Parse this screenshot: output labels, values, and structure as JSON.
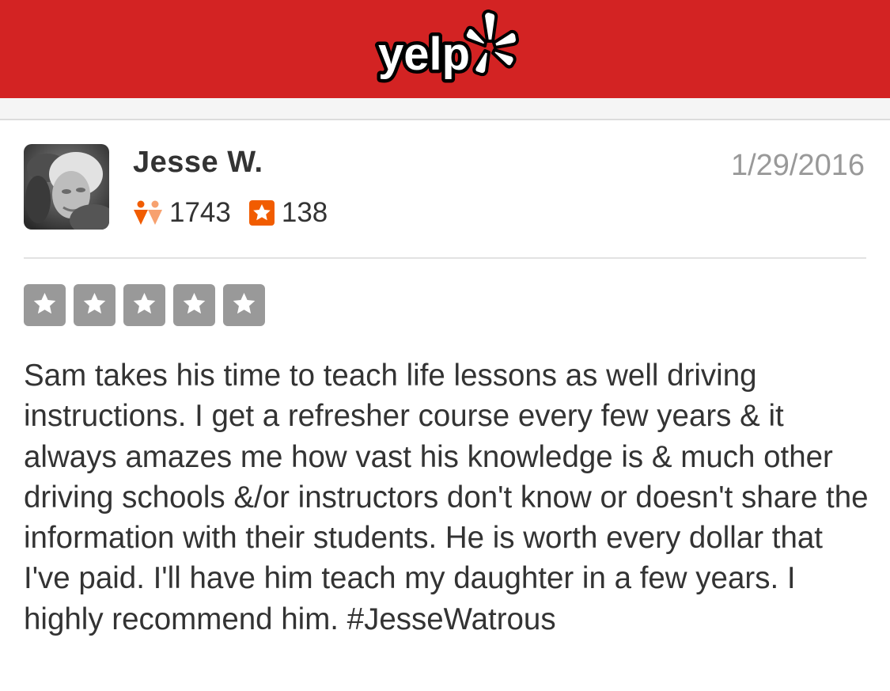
{
  "header": {
    "logo_text": "yelp",
    "brand_color": "#d32323"
  },
  "review": {
    "user_name": "Jesse W.",
    "date": "1/29/2016",
    "friends_count": "1743",
    "reviews_count": "138",
    "rating": 5,
    "max_rating": 5,
    "body": "Sam takes his time to teach life lessons as well driving instructions. I get a refresher course every few years & it always amazes me how vast his knowledge is & much other driving schools &/or instructors don't know or doesn't share the information with their students. He is worth every dollar that I've paid. I'll have him teach my daughter in a few years. I highly recommend him. #JesseWatrous"
  },
  "icons": {
    "friends": "friends-icon",
    "reviews": "review-star-icon",
    "rating_star": "star-icon"
  },
  "colors": {
    "star_box": "#999999",
    "accent_orange": "#f15c00",
    "muted_text": "#999999"
  }
}
